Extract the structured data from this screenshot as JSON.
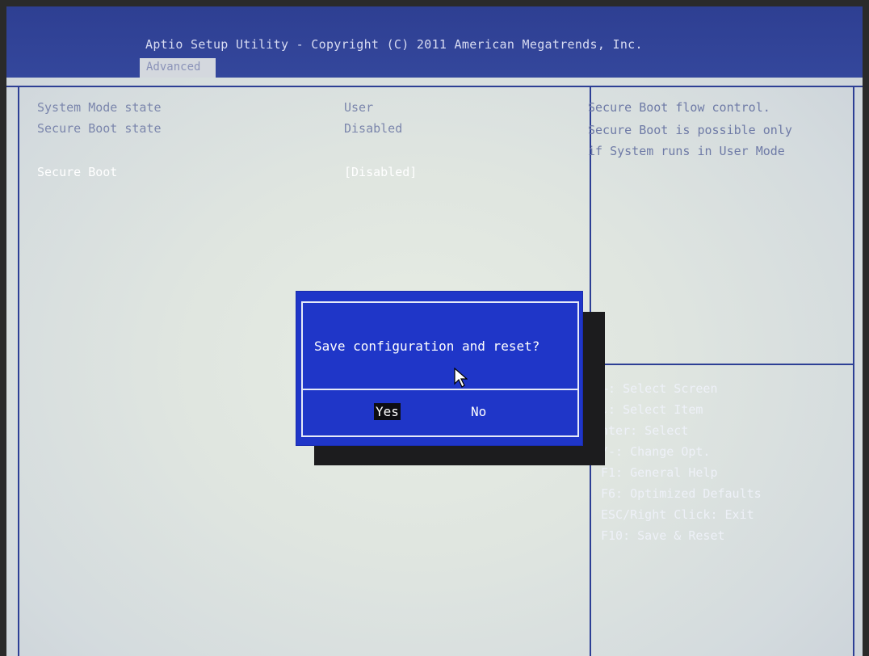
{
  "header": {
    "title": "Aptio Setup Utility - Copyright (C) 2011 American Megatrends, Inc.",
    "tab": "Advanced"
  },
  "items": [
    {
      "label": "System Mode state",
      "value": "User"
    },
    {
      "label": "Secure Boot state",
      "value": "Disabled"
    },
    {
      "label": "Secure Boot",
      "value": "[Disabled]"
    }
  ],
  "help": {
    "lines": [
      "Secure Boot flow control.",
      "Secure Boot is possible only",
      "if System runs in User Mode"
    ]
  },
  "keys": [
    "←: Select Screen",
    "↓: Select Item",
    "nter: Select",
    "/-: Change Opt.",
    "F1: General Help",
    "F6: Optimized Defaults",
    "ESC/Right Click: Exit",
    "F10: Save & Reset"
  ],
  "dialog": {
    "message": "Save configuration and reset?",
    "yes": "Yes",
    "no": "No"
  },
  "colors": {
    "header_bg": "#2e3f92",
    "dialog_bg": "#1f36c8",
    "screen_bg": "#dfe5e0"
  },
  "icons": {
    "cursor": "mouse-pointer-icon"
  }
}
